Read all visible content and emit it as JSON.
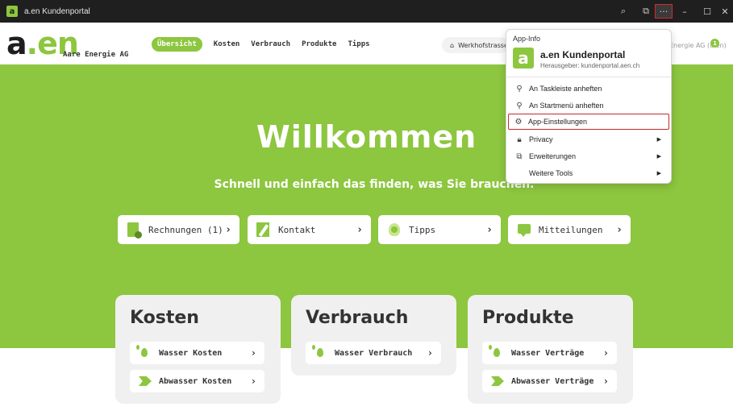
{
  "window": {
    "title": "a.en Kundenportal",
    "controls": {
      "search": "⌕",
      "share": "⧉",
      "more": "···",
      "minimize": "–",
      "maximize": "☐",
      "close": "✕"
    }
  },
  "header": {
    "logo_text": "a.en",
    "company": "Aare Energie AG",
    "nav": [
      "Übersicht",
      "Kosten",
      "Verbrauch",
      "Produkte",
      "Tipps"
    ],
    "address": "Werkhofstrasse",
    "user": "Energie AG (a.en)",
    "badge": "1"
  },
  "hero": {
    "title": "Willkommen",
    "subtitle": "Schnell und einfach das finden, was Sie brauchen."
  },
  "quick_links": [
    {
      "label": "Rechnungen (1)",
      "icon": "invoice-icon"
    },
    {
      "label": "Kontakt",
      "icon": "contact-form-icon"
    },
    {
      "label": "Tipps",
      "icon": "lightbulb-icon"
    },
    {
      "label": "Mitteilungen",
      "icon": "message-icon"
    }
  ],
  "cards": [
    {
      "title": "Kosten",
      "links": [
        "Wasser Kosten",
        "Abwasser Kosten"
      ]
    },
    {
      "title": "Verbrauch",
      "links": [
        "Wasser Verbrauch"
      ]
    },
    {
      "title": "Produkte",
      "links": [
        "Wasser Verträge",
        "Abwasser Verträge"
      ]
    }
  ],
  "menu": {
    "header": "App-Info",
    "app_name": "a.en Kundenportal",
    "publisher": "Herausgeber: kundenportal.aen.ch",
    "items": [
      {
        "label": "An Taskleiste anheften",
        "icon": "pin-icon",
        "submenu": false
      },
      {
        "label": "An Startmenü anheften",
        "icon": "pin-icon",
        "submenu": false
      },
      {
        "label": "App-Einstellungen",
        "icon": "settings-icon",
        "submenu": false,
        "highlighted": true
      },
      {
        "label": "Privacy",
        "icon": "lock-icon",
        "submenu": true
      },
      {
        "label": "Erweiterungen",
        "icon": "extension-icon",
        "submenu": true
      },
      {
        "label": "Weitere Tools",
        "icon": "",
        "submenu": true
      }
    ]
  },
  "colors": {
    "brand_green": "#8dc63f",
    "titlebar": "#1f1f1f",
    "highlight_red": "#c42b2b"
  }
}
